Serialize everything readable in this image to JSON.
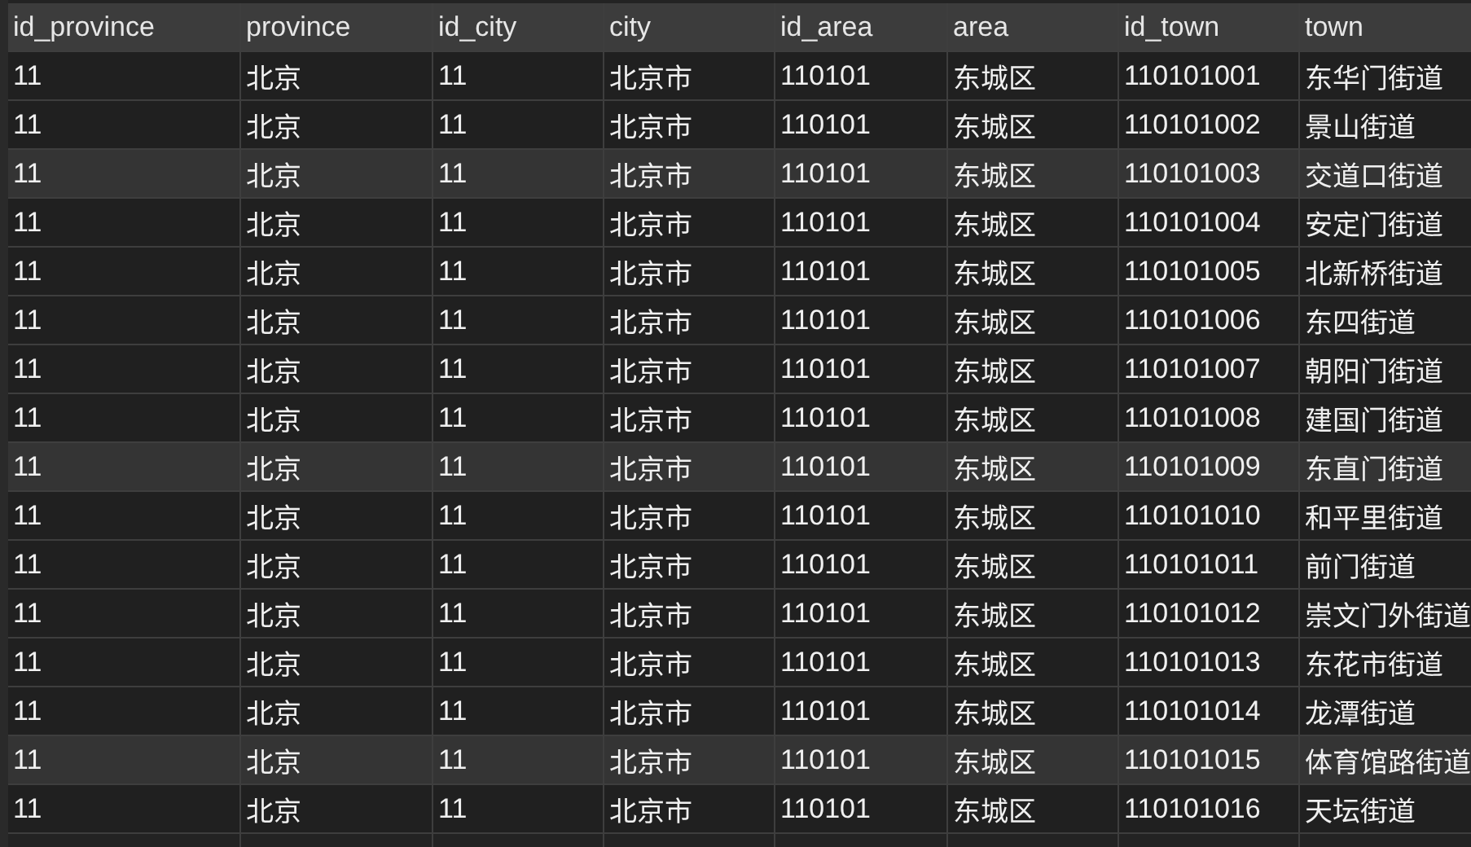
{
  "table": {
    "columns": [
      "id_province",
      "province",
      "id_city",
      "city",
      "id_area",
      "area",
      "id_town",
      "town"
    ],
    "rows": [
      {
        "cells": [
          "11",
          "北京",
          "11",
          "北京市",
          "110101",
          "东城区",
          "110101001",
          "东华门街道"
        ],
        "shaded": false
      },
      {
        "cells": [
          "11",
          "北京",
          "11",
          "北京市",
          "110101",
          "东城区",
          "110101002",
          "景山街道"
        ],
        "shaded": false
      },
      {
        "cells": [
          "11",
          "北京",
          "11",
          "北京市",
          "110101",
          "东城区",
          "110101003",
          "交道口街道"
        ],
        "shaded": true
      },
      {
        "cells": [
          "11",
          "北京",
          "11",
          "北京市",
          "110101",
          "东城区",
          "110101004",
          "安定门街道"
        ],
        "shaded": false
      },
      {
        "cells": [
          "11",
          "北京",
          "11",
          "北京市",
          "110101",
          "东城区",
          "110101005",
          "北新桥街道"
        ],
        "shaded": false
      },
      {
        "cells": [
          "11",
          "北京",
          "11",
          "北京市",
          "110101",
          "东城区",
          "110101006",
          "东四街道"
        ],
        "shaded": false
      },
      {
        "cells": [
          "11",
          "北京",
          "11",
          "北京市",
          "110101",
          "东城区",
          "110101007",
          "朝阳门街道"
        ],
        "shaded": false
      },
      {
        "cells": [
          "11",
          "北京",
          "11",
          "北京市",
          "110101",
          "东城区",
          "110101008",
          "建国门街道"
        ],
        "shaded": false
      },
      {
        "cells": [
          "11",
          "北京",
          "11",
          "北京市",
          "110101",
          "东城区",
          "110101009",
          "东直门街道"
        ],
        "shaded": true
      },
      {
        "cells": [
          "11",
          "北京",
          "11",
          "北京市",
          "110101",
          "东城区",
          "110101010",
          "和平里街道"
        ],
        "shaded": false
      },
      {
        "cells": [
          "11",
          "北京",
          "11",
          "北京市",
          "110101",
          "东城区",
          "110101011",
          "前门街道"
        ],
        "shaded": false
      },
      {
        "cells": [
          "11",
          "北京",
          "11",
          "北京市",
          "110101",
          "东城区",
          "110101012",
          "崇文门外街道"
        ],
        "shaded": false
      },
      {
        "cells": [
          "11",
          "北京",
          "11",
          "北京市",
          "110101",
          "东城区",
          "110101013",
          "东花市街道"
        ],
        "shaded": false
      },
      {
        "cells": [
          "11",
          "北京",
          "11",
          "北京市",
          "110101",
          "东城区",
          "110101014",
          "龙潭街道"
        ],
        "shaded": false
      },
      {
        "cells": [
          "11",
          "北京",
          "11",
          "北京市",
          "110101",
          "东城区",
          "110101015",
          "体育馆路街道"
        ],
        "shaded": true
      },
      {
        "cells": [
          "11",
          "北京",
          "11",
          "北京市",
          "110101",
          "东城区",
          "110101016",
          "天坛街道"
        ],
        "shaded": false
      }
    ]
  }
}
